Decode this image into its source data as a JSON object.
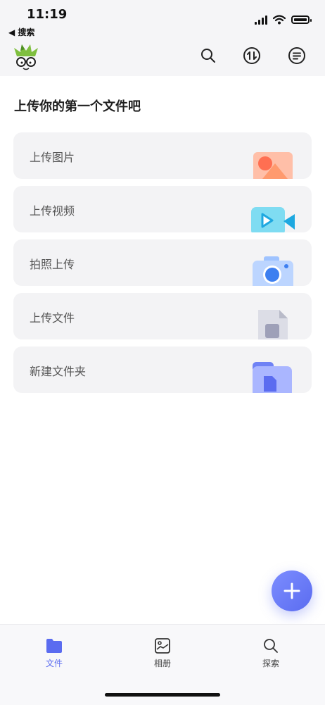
{
  "status_bar": {
    "time": "11:19",
    "back_label": "◀ 搜索"
  },
  "header": {
    "avatar_icon": "green-hair-glasses-avatar",
    "search_icon": "search-icon",
    "transfer_icon": "transfer-arrows-icon",
    "menu_icon": "list-menu-icon"
  },
  "main": {
    "title": "上传你的第一个文件吧",
    "cards": [
      {
        "label": "上传图片",
        "icon": "image-icon"
      },
      {
        "label": "上传视频",
        "icon": "video-camera-icon"
      },
      {
        "label": "拍照上传",
        "icon": "camera-icon"
      },
      {
        "label": "上传文件",
        "icon": "document-icon"
      },
      {
        "label": "新建文件夹",
        "icon": "folder-icon"
      }
    ]
  },
  "fab": {
    "icon": "plus-icon"
  },
  "tabbar": {
    "tabs": [
      {
        "label": "文件",
        "icon": "folder-icon",
        "active": true
      },
      {
        "label": "相册",
        "icon": "photo-album-icon",
        "active": false
      },
      {
        "label": "探索",
        "icon": "search-icon",
        "active": false
      }
    ]
  },
  "colors": {
    "accent": "#5b6cf0",
    "card_bg": "#f3f3f5",
    "header_bg": "#f5f5f7"
  }
}
